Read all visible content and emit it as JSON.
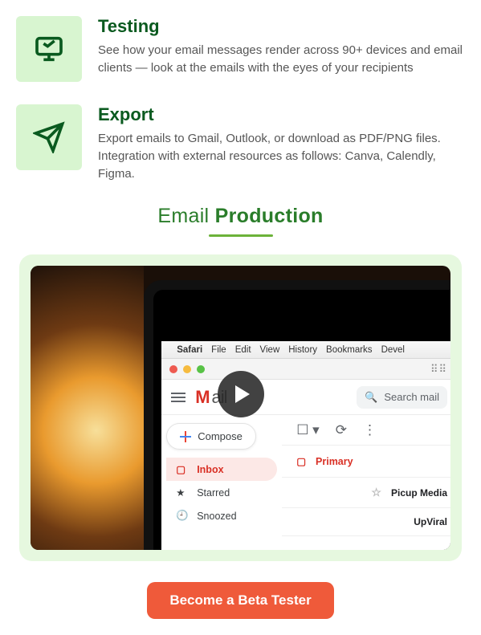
{
  "features": [
    {
      "title": "Testing",
      "desc": "See how your email messages render across 90+ devices and email clients — look at the emails with the eyes of your recipients"
    },
    {
      "title": "Export",
      "desc": "Export emails to Gmail, Outlook, or download as PDF/PNG files. Integration with external resources as follows: Canva, Calendly, Figma."
    }
  ],
  "section": {
    "title_light": "Email ",
    "title_bold": "Production"
  },
  "mac": {
    "menu": [
      "Safari",
      "File",
      "Edit",
      "View",
      "History",
      "Bookmarks",
      "Devel"
    ]
  },
  "gmail": {
    "logo_tail": "ail",
    "search_placeholder": "Search mail",
    "compose": "Compose",
    "sidebar": [
      "Inbox",
      "Starred",
      "Snoozed"
    ],
    "primary_tab": "Primary",
    "rows": [
      "Picup Media",
      "UpViral"
    ]
  },
  "cta": "Become a Beta Tester"
}
